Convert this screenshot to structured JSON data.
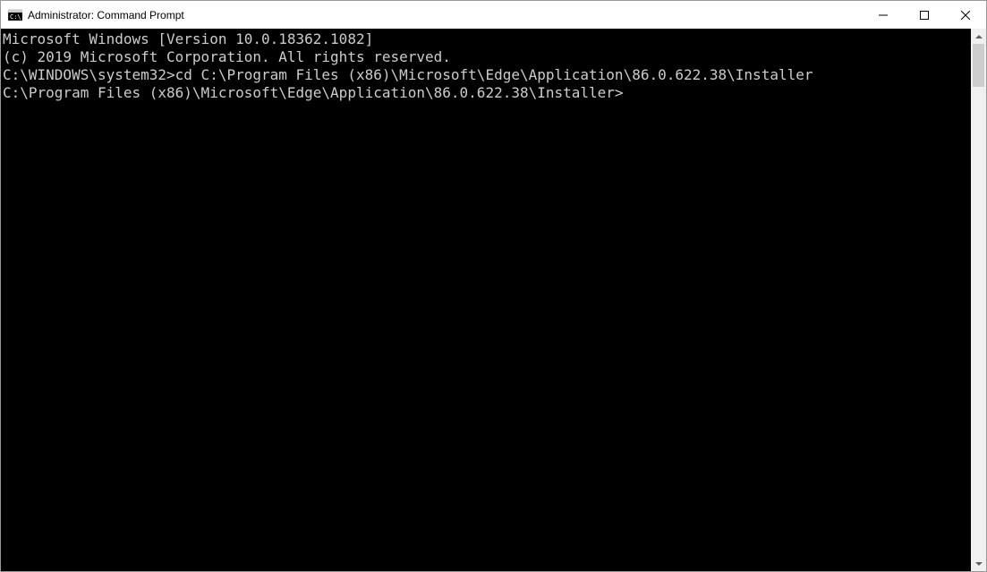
{
  "window": {
    "title": "Administrator: Command Prompt"
  },
  "terminal": {
    "lines": [
      "Microsoft Windows [Version 10.0.18362.1082]",
      "(c) 2019 Microsoft Corporation. All rights reserved.",
      "",
      "C:\\WINDOWS\\system32>cd C:\\Program Files (x86)\\Microsoft\\Edge\\Application\\86.0.622.38\\Installer",
      "",
      "C:\\Program Files (x86)\\Microsoft\\Edge\\Application\\86.0.622.38\\Installer>"
    ]
  }
}
